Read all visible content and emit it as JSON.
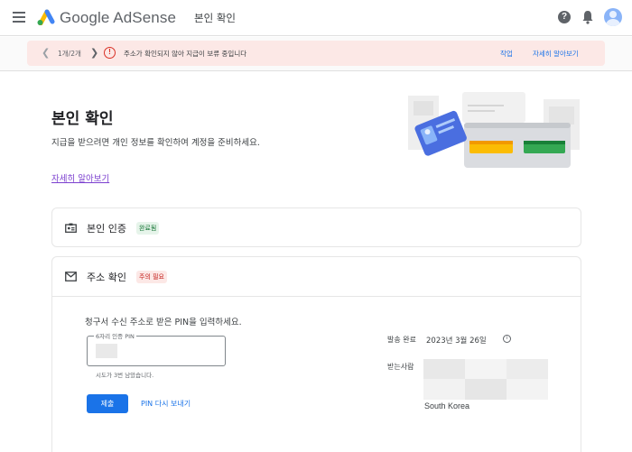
{
  "header": {
    "brand": "Google AdSense",
    "title": "본인 확인",
    "help_icon": "help-circle-icon",
    "help_glyph": "?",
    "bell_icon": "notifications-icon",
    "avatar_icon": "account-avatar-icon"
  },
  "banner": {
    "pager": "1개/2개",
    "alert_glyph": "!",
    "message": "주소가 확인되지 않아 지급이 보류 중입니다",
    "action_link": "작업",
    "more_link": "자세히 알아보기",
    "colors": {
      "background": "#fce8e6",
      "icon": "#d93025",
      "link": "#1a73e8"
    }
  },
  "main": {
    "title": "본인 확인",
    "intro": "지급을 받으려면 개인 정보를 확인하여 계정을 준비하세요.",
    "learn_more": "자세히 알아보기"
  },
  "identity_card": {
    "title": "본인 인증",
    "status": "완료됨",
    "icon": "id-badge-icon"
  },
  "address_card": {
    "title": "주소 확인",
    "status": "주의 필요",
    "icon": "mail-icon",
    "prompt": "청구서 수신 주소로 받은 PIN을 입력하세요.",
    "pin_label": "6자리 인증 PIN",
    "pin_value": "",
    "attempts": "시도가 3번 남았습니다.",
    "submit": "제출",
    "resend": "PIN 다시 보내기",
    "sent_label": "발송 완료",
    "sent_date": "2023년 3월 26일",
    "info_glyph": "i",
    "recipient_label": "받는사람",
    "country": "South Korea"
  },
  "colors": {
    "accent": "#1a73e8",
    "success_chip": "#e6f4ea",
    "warning_chip": "#fce8e6"
  }
}
